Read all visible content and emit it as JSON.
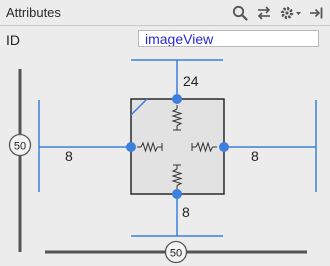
{
  "header": {
    "title": "Attributes",
    "icons": [
      "search-icon",
      "swap-icon",
      "gear-icon",
      "pin-to-side-icon"
    ]
  },
  "id_field": {
    "label": "ID",
    "value": "imageView"
  },
  "constraints": {
    "top_margin": "24",
    "bottom_margin": "8",
    "left_margin": "8",
    "right_margin": "8",
    "vertical_bias": "50",
    "horizontal_bias": "50"
  },
  "colors": {
    "accent": "#3d7fdc",
    "text_value": "#2a2ad8",
    "box_fill": "#e2e2e2",
    "box_border": "#2b2b2b"
  }
}
